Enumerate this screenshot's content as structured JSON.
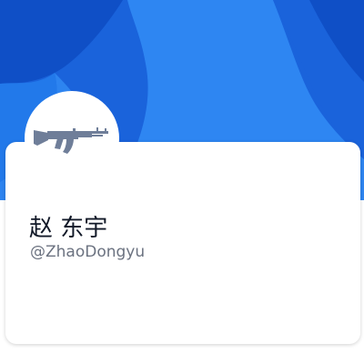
{
  "profile": {
    "display_name": "赵 东宇",
    "handle": "@ZhaoDongyu",
    "avatar_icon": "rifle-icon"
  },
  "colors": {
    "banner_base": "#1f6fe3",
    "banner_light": "#3a8cf5",
    "banner_dark": "#0e47b9",
    "icon_gray": "#6f7e99",
    "name_text": "#111827",
    "handle_text": "#6b7280"
  }
}
